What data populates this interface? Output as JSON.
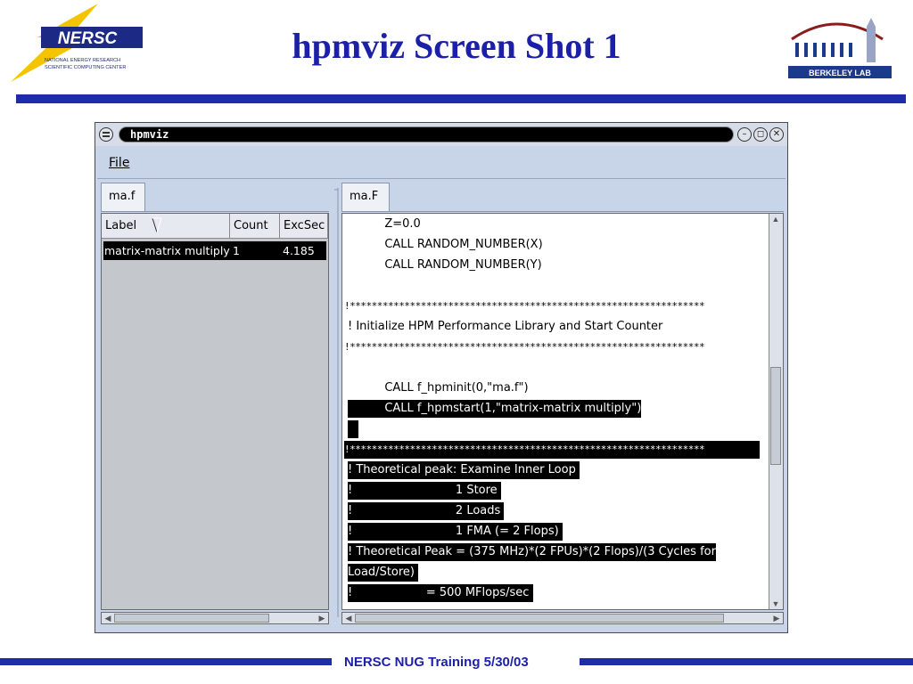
{
  "slide": {
    "title": "hpmviz Screen Shot 1",
    "footer": "NERSC NUG Training 5/30/03",
    "accent_color": "#1f2ca8",
    "logos": [
      {
        "name": "nersc-logo",
        "text": "NERSC",
        "subtext": [
          "NATIONAL ENERGY RESEARCH",
          "SCIENTIFIC COMPUTING CENTER"
        ]
      },
      {
        "name": "berkeley-lab-logo",
        "text": "BERKELEY LAB"
      }
    ]
  },
  "window": {
    "title": "hpmviz",
    "buttons": [
      "minimize",
      "maximize",
      "close"
    ],
    "menu": {
      "file": "File"
    }
  },
  "left_pane": {
    "tab": "ma.f",
    "columns": [
      "Label",
      "Count",
      "ExcSec"
    ],
    "rows": [
      {
        "label": "matrix-matrix multiply",
        "count": "1",
        "excsec": "4.185",
        "selected": true
      }
    ]
  },
  "right_pane": {
    "tab": "ma.F",
    "lines": [
      {
        "text": "          Z=0.0",
        "selected": false
      },
      {
        "text": "          CALL RANDOM_NUMBER(X)",
        "selected": false
      },
      {
        "text": "          CALL RANDOM_NUMBER(Y)",
        "selected": false
      },
      {
        "text": "",
        "selected": false
      },
      {
        "text": "!*****************************************************************",
        "selected": false
      },
      {
        "text": "! Initialize HPM Performance Library and Start Counter",
        "selected": false
      },
      {
        "text": "!*****************************************************************",
        "selected": false
      },
      {
        "text": "",
        "selected": false
      },
      {
        "text": "          CALL f_hpminit(0,\"ma.f\")",
        "selected": false
      },
      {
        "text": "          CALL f_hpmstart(1,\"matrix-matrix multiply\")",
        "selected": true
      },
      {
        "text": "   ",
        "selected": true
      },
      {
        "text": "!*****************************************************************",
        "selected": true
      },
      {
        "text": "! Theoretical peak: Examine Inner Loop ",
        "selected": true
      },
      {
        "text": "!                            1 Store ",
        "selected": true
      },
      {
        "text": "!                            2 Loads ",
        "selected": true
      },
      {
        "text": "!                            1 FMA (= 2 Flops) ",
        "selected": true
      },
      {
        "text": "! Theoretical Peak = (375 MHz)*(2 FPUs)*(2 Flops)/(3 Cycles for",
        "selected": true
      },
      {
        "text": "Load/Store) ",
        "selected": true
      },
      {
        "text": "!                    = 500 MFlops/sec ",
        "selected": true
      }
    ]
  }
}
